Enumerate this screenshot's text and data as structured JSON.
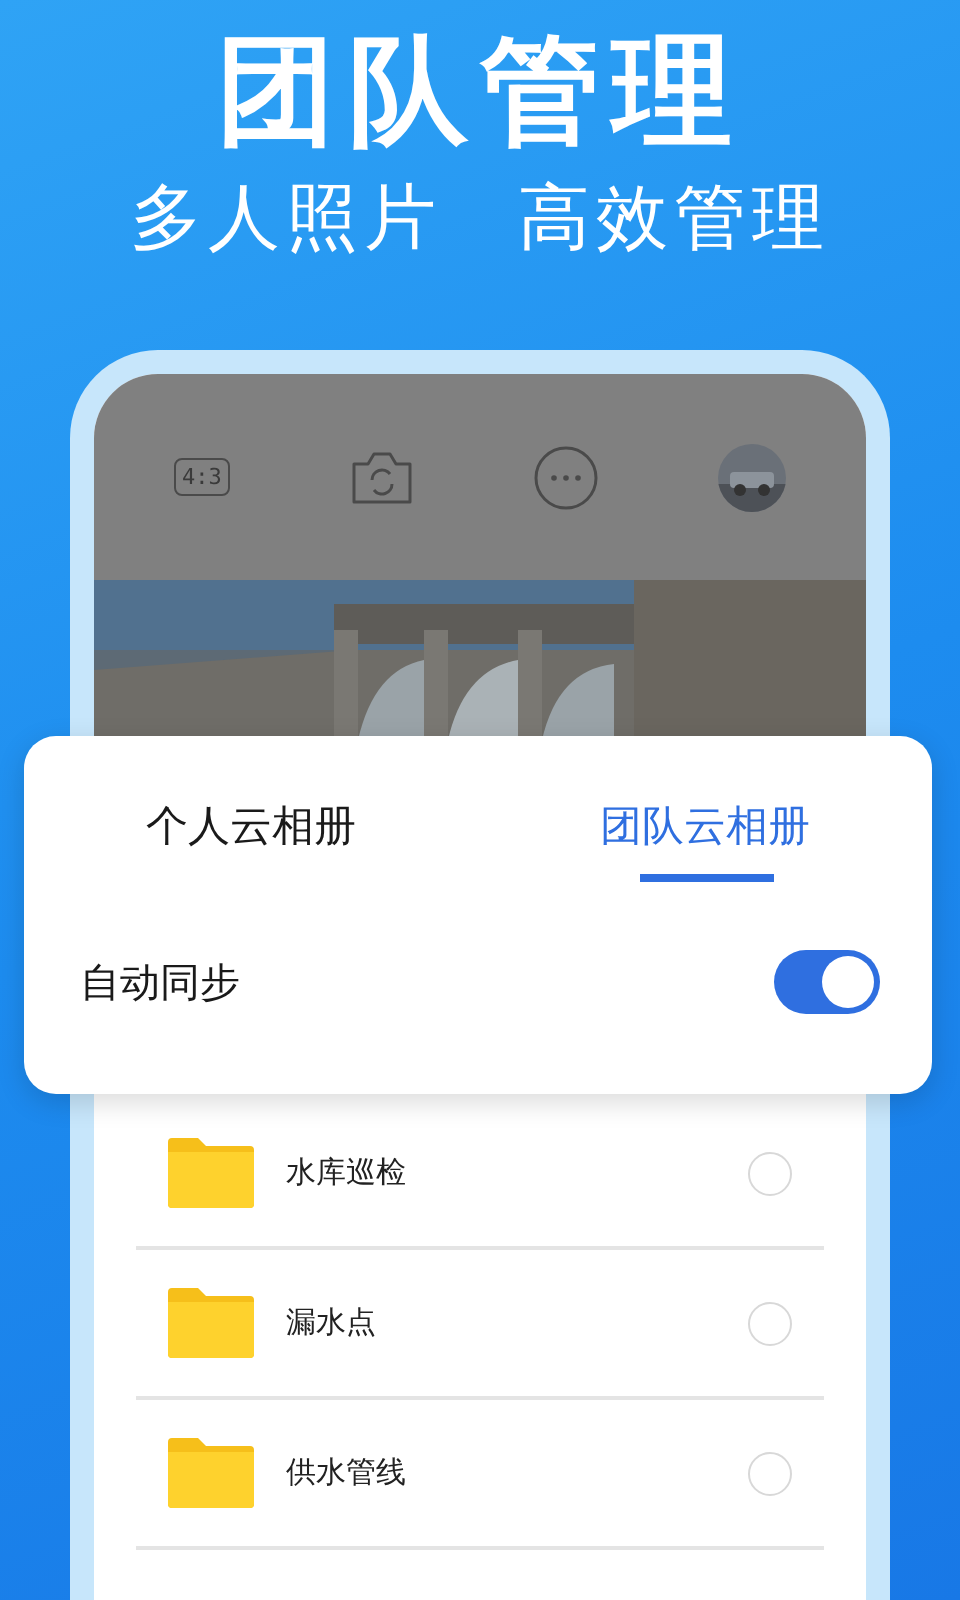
{
  "header": {
    "title": "团队管理",
    "subtitles": [
      "多人照片",
      "高效管理"
    ]
  },
  "camera_bar": {
    "ratio": "4:3"
  },
  "album_tabs": [
    {
      "label": "个人云相册",
      "selected": false
    },
    {
      "label": "团队云相册",
      "selected": true
    }
  ],
  "auto_sync": {
    "label": "自动同步",
    "on": true
  },
  "folders": [
    {
      "name": "水库巡检",
      "checked": false
    },
    {
      "name": "漏水点",
      "checked": false
    },
    {
      "name": "供水管线",
      "checked": false
    }
  ]
}
